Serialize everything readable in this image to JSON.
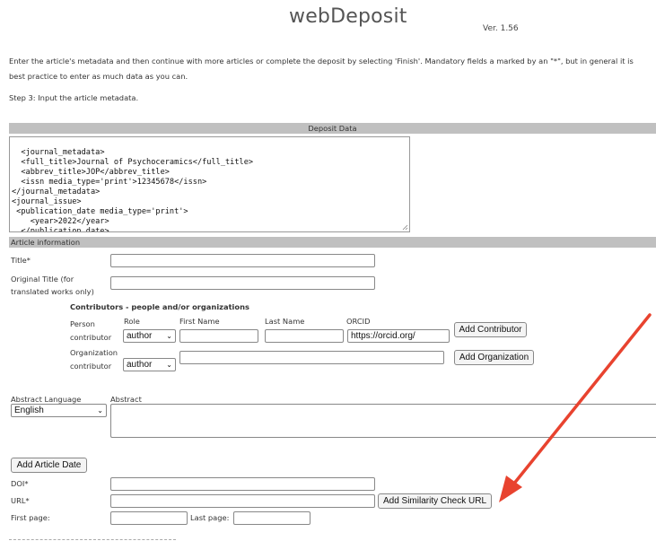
{
  "header": {
    "logo": "webDeposit",
    "version": "Ver. 1.56"
  },
  "intro": {
    "text": "Enter the article's metadata and then continue with more articles or complete the deposit by selecting 'Finish'. Mandatory fields a marked by an \"*\", but in general it is best practice to enter as much data as you can.",
    "step": "Step 3: Input the article metadata."
  },
  "deposit": {
    "header": "Deposit Data",
    "xml": "<journal_metadata>\n  <full_title>Journal of Psychoceramics</full_title>\n  <abbrev_title>JOP</abbrev_title>\n  <issn media_type='print'>12345678</issn>\n</journal_metadata>\n<journal_issue>\n <publication_date media_type='print'>\n    <year>2022</year>\n  </publication_date>\n</journal_issue>"
  },
  "article": {
    "header": "Article information",
    "title_label": "Title*",
    "original_title_label": "Original Title (for translated works only)",
    "contributors_header": "Contributors - people and/or organizations",
    "person_label": "Person contributor",
    "role_label": "Role",
    "first_name_label": "First Name",
    "last_name_label": "Last Name",
    "orcid_label": "ORCID",
    "person_role": "author",
    "orcid_value": "https://orcid.org/",
    "add_contributor": "Add Contributor",
    "org_label": "Organization contributor",
    "org_role": "author",
    "add_organization": "Add Organization",
    "abstract_language_label": "Abstract Language",
    "abstract_language": "English",
    "abstract_label": "Abstract",
    "add_article_date": "Add Article Date",
    "doi_label": "DOI*",
    "url_label": "URL*",
    "add_similarity": "Add Similarity Check URL",
    "first_page_label": "First page:",
    "last_page_label": "Last page:"
  },
  "annotation": {
    "arrow_color": "#e8432f"
  }
}
